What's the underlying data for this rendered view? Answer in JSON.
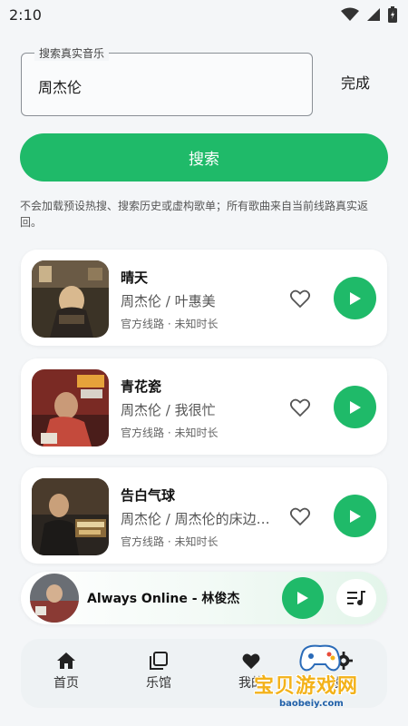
{
  "status_bar": {
    "time": "2:10"
  },
  "search": {
    "legend": "搜索真实音乐",
    "value": "周杰伦",
    "done_label": "完成",
    "button_label": "搜索"
  },
  "notice": "不会加载预设热搜、搜索历史或虚构歌单；所有歌曲来自当前线路真实返回。",
  "songs": [
    {
      "title": "晴天",
      "artist": "周杰伦 / 叶惠美",
      "meta": "官方线路 · 未知时长"
    },
    {
      "title": "青花瓷",
      "artist": "周杰伦 / 我很忙",
      "meta": "官方线路 · 未知时长"
    },
    {
      "title": "告白气球",
      "artist": "周杰伦 / 周杰伦的床边故事",
      "meta": "官方线路 · 未知时长"
    }
  ],
  "mini_player": {
    "title": "Always Online - 林俊杰"
  },
  "nav": [
    {
      "label": "首页",
      "icon": "home-icon"
    },
    {
      "label": "乐馆",
      "icon": "library-icon"
    },
    {
      "label": "我的",
      "icon": "heart-icon"
    },
    {
      "label": "设置",
      "icon": "gear-icon"
    }
  ],
  "watermark": {
    "text": "宝贝游戏网",
    "url": "baobeiy.com"
  },
  "colors": {
    "accent": "#1fba69",
    "background": "#f4f6f8",
    "card": "#ffffff"
  }
}
